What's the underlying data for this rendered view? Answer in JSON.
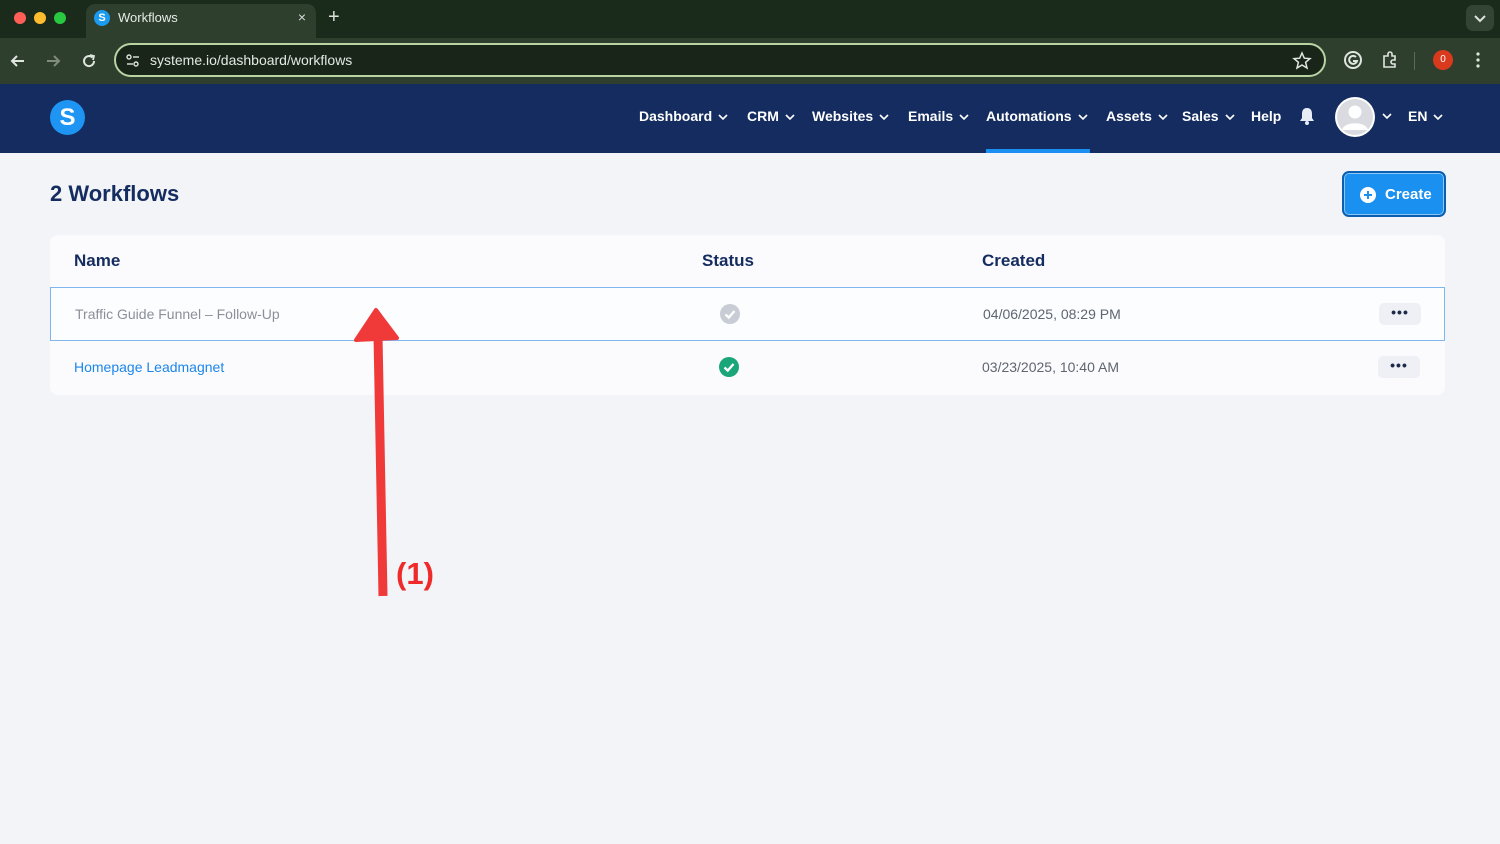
{
  "browser": {
    "tab_title": "Workflows",
    "tab_favicon_letter": "S",
    "tab_close_glyph": "×",
    "new_tab_glyph": "+",
    "url": "systeme.io/dashboard/workflows",
    "extension_badge": "0"
  },
  "app": {
    "logo_letter": "S",
    "nav": [
      {
        "label": "Dashboard",
        "has_dropdown": true
      },
      {
        "label": "CRM",
        "has_dropdown": true
      },
      {
        "label": "Websites",
        "has_dropdown": true
      },
      {
        "label": "Emails",
        "has_dropdown": true
      },
      {
        "label": "Automations",
        "has_dropdown": true,
        "active": true
      },
      {
        "label": "Assets",
        "has_dropdown": true
      },
      {
        "label": "Sales",
        "has_dropdown": true
      },
      {
        "label": "Help",
        "has_dropdown": false
      }
    ],
    "language": "EN",
    "accent_color": "#1b8ef2",
    "nav_background": "#142c5f"
  },
  "page": {
    "title": "2 Workflows",
    "create_label": "Create"
  },
  "table": {
    "headers": {
      "name": "Name",
      "status": "Status",
      "created": "Created"
    },
    "rows": [
      {
        "name": "Traffic Guide Funnel – Follow-Up",
        "status": "inactive",
        "created": "04/06/2025, 08:29 PM",
        "more": "•••"
      },
      {
        "name": "Homepage Leadmagnet",
        "status": "active",
        "created": "03/23/2025, 10:40 AM",
        "more": "•••"
      }
    ]
  },
  "annotation": {
    "label": "(1)",
    "color": "#ee2a2a"
  }
}
